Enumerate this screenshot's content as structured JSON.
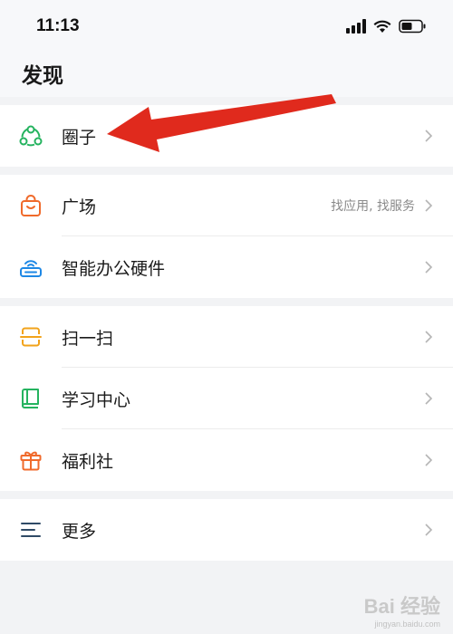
{
  "status_bar": {
    "time": "11:13"
  },
  "page_title": "发现",
  "groups": [
    {
      "items": [
        {
          "label": "圈子",
          "icon": "circle-share-icon"
        }
      ]
    },
    {
      "items": [
        {
          "label": "广场",
          "sub": "找应用, 找服务",
          "icon": "bag-icon"
        },
        {
          "label": "智能办公硬件",
          "icon": "router-icon"
        }
      ]
    },
    {
      "items": [
        {
          "label": "扫一扫",
          "icon": "scan-icon"
        },
        {
          "label": "学习中心",
          "icon": "book-icon"
        },
        {
          "label": "福利社",
          "icon": "gift-icon"
        }
      ]
    },
    {
      "items": [
        {
          "label": "更多",
          "icon": "menu-icon"
        }
      ]
    }
  ],
  "colors": {
    "green": "#25b35f",
    "orange": "#f06a2b",
    "blue": "#1e88e5",
    "yellow": "#f2a31b",
    "arrow": "#e02a1d"
  },
  "watermark": {
    "text": "Bai 经验",
    "sub": "jingyan.baidu.com"
  }
}
